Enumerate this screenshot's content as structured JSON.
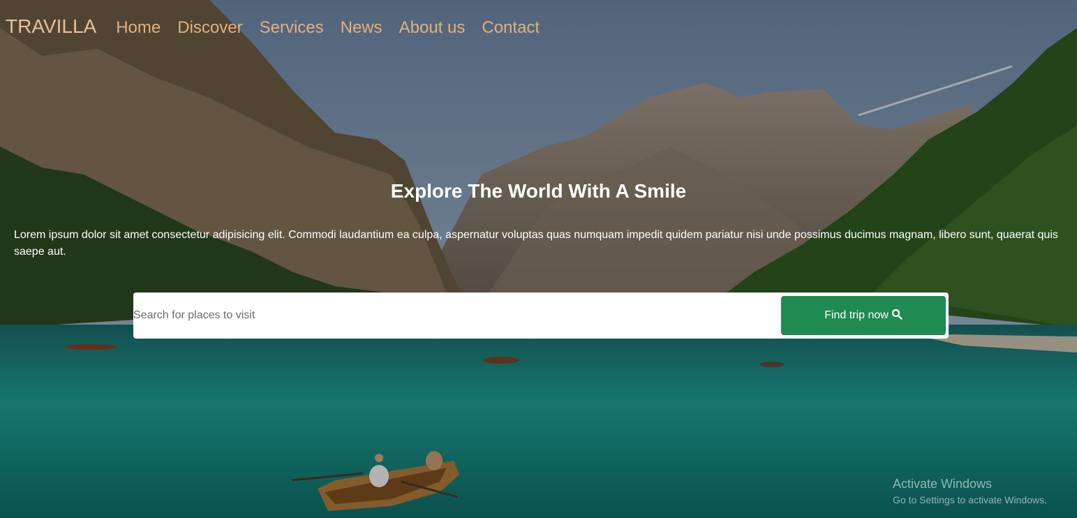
{
  "nav": {
    "brand": "TRAVILLA",
    "links": [
      "Home",
      "Discover",
      "Services",
      "News",
      "About us",
      "Contact"
    ]
  },
  "hero": {
    "title": "Explore The World With A Smile",
    "description": "Lorem ipsum dolor sit amet consectetur adipisicing elit. Commodi laudantium ea culpa, aspernatur voluptas quas numquam impedit quidem pariatur nisi unde possimus ducimus magnam, libero sunt, quaerat quis saepe aut."
  },
  "search": {
    "placeholder": "Search for places to visit",
    "button_label": "Find trip now"
  },
  "watermark": {
    "line1": "Activate Windows",
    "line2": "Go to Settings to activate Windows."
  },
  "colors": {
    "nav_text": "#e3b07a",
    "button_bg": "#1f8a52"
  },
  "icons": {
    "search_button_icon": "search-icon"
  }
}
